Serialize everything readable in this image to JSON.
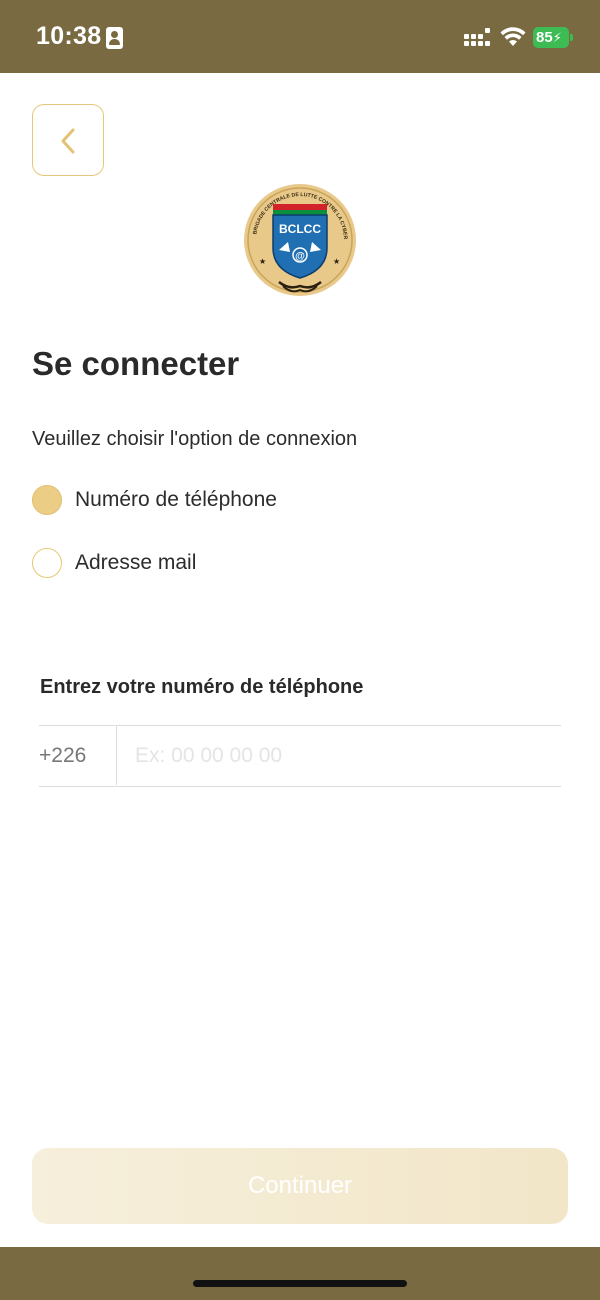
{
  "status_bar": {
    "time": "10:38",
    "battery": "85",
    "icons": [
      "contact-card-icon",
      "cellular-signal-icon",
      "wifi-icon",
      "battery-charging-icon"
    ]
  },
  "header": {
    "back_icon": "chevron-left-icon"
  },
  "logo": {
    "text": "BCLCC",
    "ring_text": "BRIGADE CENTRALE DE LUTTE CONTRE LA CYBERCRIMINALITE",
    "symbol": "@"
  },
  "login": {
    "title": "Se connecter",
    "instruction": "Veuillez choisir l'option de connexion",
    "options": [
      {
        "label": "Numéro de téléphone",
        "selected": true
      },
      {
        "label": "Adresse mail",
        "selected": false
      }
    ],
    "phone_label": "Entrez votre numéro de téléphone",
    "country_code": "+226",
    "phone_placeholder": "Ex: 00 00 00 00",
    "phone_value": ""
  },
  "actions": {
    "continue_label": "Continuer"
  },
  "colors": {
    "status_bar_bg": "#7a6a41",
    "accent": "#e6c874",
    "radio_selected": "#ebcd85",
    "button_bg": "#f4ebd2",
    "battery": "#3dbc54"
  }
}
